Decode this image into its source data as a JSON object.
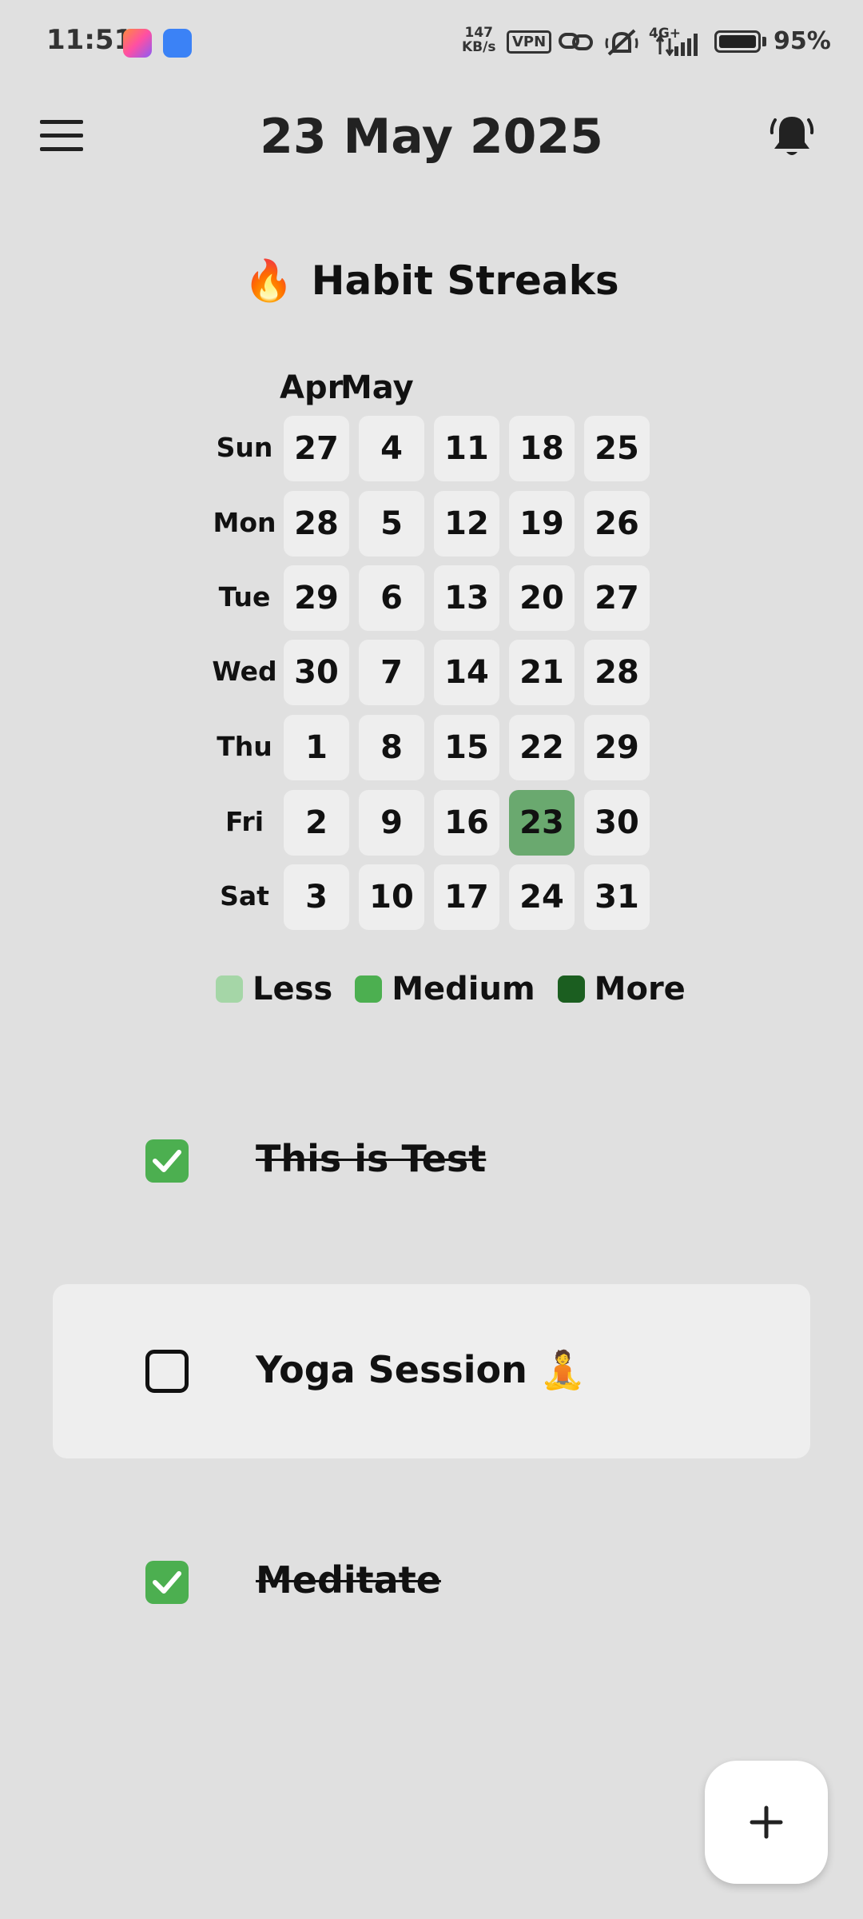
{
  "status_bar": {
    "time": "11:51",
    "net_speed_value": "147",
    "net_speed_unit": "KB/s",
    "vpn_label": "VPN",
    "network_type": "4G+",
    "battery_percent": "95%"
  },
  "header": {
    "date_title": "23 May 2025",
    "menu_icon": "hamburger-menu-icon",
    "bell_icon": "notification-bell-icon"
  },
  "streaks": {
    "title_emoji": "🔥",
    "title": "Habit Streaks",
    "months": [
      "Apr",
      "May"
    ],
    "day_labels": [
      "Sun",
      "Mon",
      "Tue",
      "Wed",
      "Thu",
      "Fri",
      "Sat"
    ],
    "weeks": [
      [
        "27",
        "28",
        "29",
        "30",
        "1",
        "2",
        "3"
      ],
      [
        "4",
        "5",
        "6",
        "7",
        "8",
        "9",
        "10"
      ],
      [
        "11",
        "12",
        "13",
        "14",
        "15",
        "16",
        "17"
      ],
      [
        "18",
        "19",
        "20",
        "21",
        "22",
        "23",
        "24"
      ],
      [
        "25",
        "26",
        "27",
        "28",
        "29",
        "30",
        "31"
      ]
    ],
    "highlighted_day": "23",
    "legend": [
      {
        "label": "Less",
        "color": "#a5d6a7"
      },
      {
        "label": "Medium",
        "color": "#4caf50"
      },
      {
        "label": "More",
        "color": "#1b5e20"
      }
    ]
  },
  "habits": [
    {
      "label": "This is Test",
      "checked": true
    },
    {
      "label": "Yoga Session 🧘",
      "checked": false
    },
    {
      "label": "Meditate",
      "checked": true
    }
  ],
  "fab": {
    "icon": "plus-icon"
  },
  "colors": {
    "background": "#e0e0e0",
    "cell": "#eeeeee",
    "active_cell": "#6aa96f",
    "check_green": "#4caf50"
  }
}
